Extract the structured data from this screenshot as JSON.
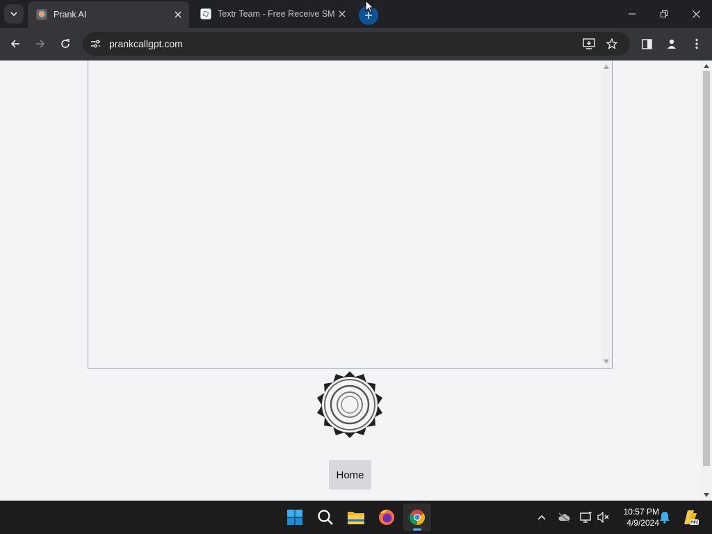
{
  "browser": {
    "tabs": [
      {
        "title": "Prank AI",
        "active": true
      },
      {
        "title": "Textr Team - Free Receive SMS",
        "active": false
      }
    ],
    "url": "prankcallgpt.com"
  },
  "page": {
    "home_button": "Home"
  },
  "taskbar": {
    "time": "10:57 PM",
    "date": "4/9/2024"
  },
  "colors": {
    "tab_active": "#35363a",
    "page_bg": "#f2f4f5",
    "newtab_accent": "#0b5394",
    "taskbar": "#1c1c1c"
  }
}
